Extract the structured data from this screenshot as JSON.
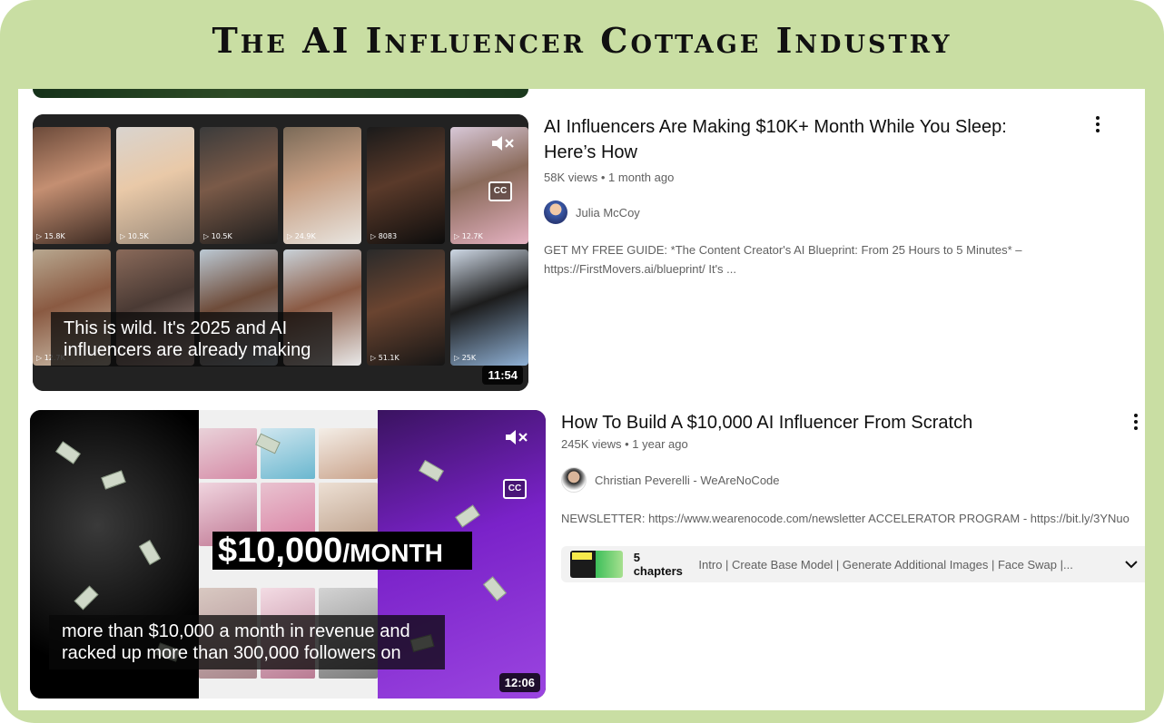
{
  "banner": {
    "title": "The AI Influencer Cottage Industry"
  },
  "videos": [
    {
      "title": "AI Influencers Are Making $10K+ Month While You Sleep: Here’s How",
      "views": "58K views",
      "age": "1 month ago",
      "channel": "Julia McCoy",
      "description": "GET MY FREE GUIDE: *The Content Creator's AI Blueprint: From 25 Hours to 5 Minutes* – https://FirstMovers.ai/blueprint/ It's ...",
      "caption": "This is wild. It's 2025 and AI influencers are already making",
      "duration": "11:54",
      "cc_label": "CC",
      "tile_counts": [
        "15.8K",
        "10.5K",
        "10.5K",
        "24.9K",
        "8083",
        "12.7K",
        "12.7K",
        "",
        "",
        "",
        "51.1K",
        "25K"
      ]
    },
    {
      "title": "How To Build A $10,000 AI Influencer From Scratch",
      "views": "245K views",
      "age": "1 year ago",
      "channel": "Christian Peverelli - WeAreNoCode",
      "description": "NEWSLETTER: https://www.wearenocode.com/newsletter ACCELERATOR PROGRAM - https://bit.ly/3YNuo",
      "caption": "more than $10,000 a month in revenue and racked up more than 300,000 followers on",
      "duration": "12:06",
      "cc_label": "CC",
      "price_banner_big": "$10,000",
      "price_banner_small": "/MONTH",
      "chapters": {
        "count_label": "5 chapters",
        "list": "Intro | Create Base Model | Generate Additional Images | Face Swap |..."
      }
    }
  ],
  "icons": [
    "mute-icon",
    "cc-icon",
    "kebab-menu-icon",
    "chevron-down-icon"
  ],
  "colors": {
    "banner_bg": "#c9dea3",
    "text_primary": "#0f0f0f",
    "text_secondary": "#606060",
    "accent_purple": "#7a22c9"
  }
}
